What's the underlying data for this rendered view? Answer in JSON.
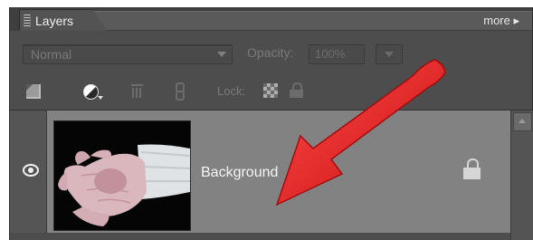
{
  "panel": {
    "tab_label": "Layers",
    "more_label": "more ▸"
  },
  "blend_mode": {
    "selected": "Normal"
  },
  "opacity": {
    "label": "Opacity:",
    "value": "100%"
  },
  "lock": {
    "label": "Lock:"
  },
  "layers": [
    {
      "name": "Background",
      "visible": true,
      "locked": true
    }
  ],
  "icons": {
    "new_layer": "new-layer-icon",
    "adjustment": "adjustment-layer-icon",
    "delete": "trash-icon",
    "link": "link-icon",
    "lock_transparent": "lock-transparency-icon",
    "lock_all": "lock-icon",
    "visibility": "eye-icon",
    "layer_lock": "lock-icon"
  },
  "colors": {
    "panel_bg": "#4d4d4d",
    "selected_row": "#828282",
    "annotation_arrow": "#e11a1a"
  }
}
